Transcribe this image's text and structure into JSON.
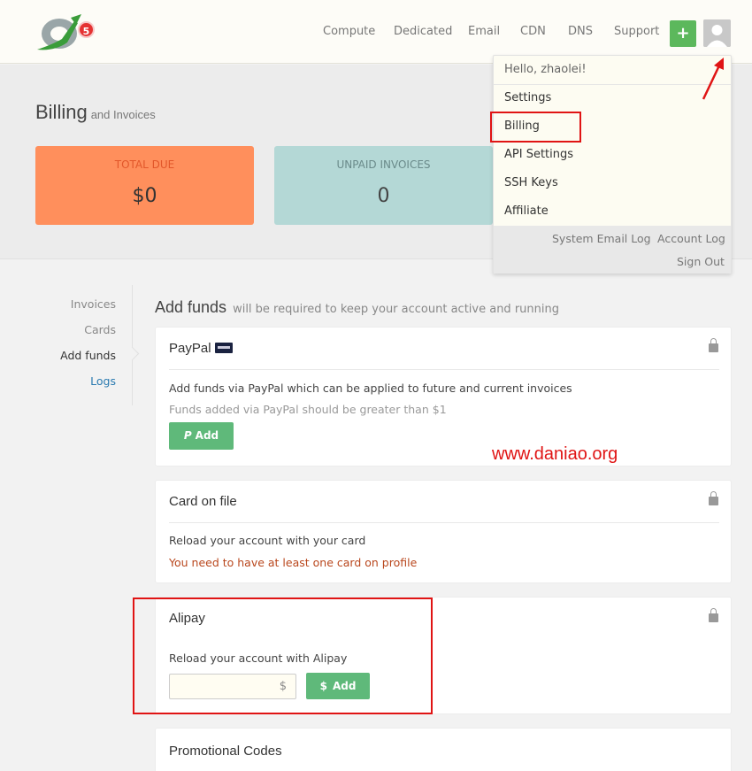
{
  "nav": {
    "items": [
      "Compute",
      "Dedicated",
      "Email",
      "CDN",
      "DNS",
      "Support"
    ],
    "plus_label": "+",
    "notification_count": "5"
  },
  "header": {
    "title": "Billing",
    "subtitle": "and Invoices",
    "total_due_label": "TOTAL DUE",
    "total_due_value": "$0",
    "unpaid_label": "UNPAID INVOICES",
    "unpaid_value": "0"
  },
  "dropdown": {
    "greeting": "Hello, zhaolei!",
    "items": [
      "Settings",
      "Billing",
      "API Settings",
      "SSH Keys",
      "Affiliate"
    ],
    "footer": {
      "system_email_log": "System Email Log",
      "account_log": "Account Log",
      "sign_out": "Sign Out"
    }
  },
  "sidebar": {
    "items": [
      "Invoices",
      "Cards",
      "Add funds",
      "Logs"
    ]
  },
  "main": {
    "title": "Add funds",
    "subtitle": "will be required to keep your account active and running",
    "paypal": {
      "title": "PayPal",
      "desc": "Add funds via PayPal which can be applied to future and current invoices",
      "note": "Funds added via PayPal should be greater than $1",
      "button": "Add",
      "button_icon": "P"
    },
    "card_on_file": {
      "title": "Card on file",
      "desc": "Reload your account with your card",
      "warning": "You need to have at least one card on profile"
    },
    "alipay": {
      "title": "Alipay",
      "desc": "Reload your account with Alipay",
      "input_suffix": "$",
      "button": "Add",
      "button_icon": "$"
    },
    "promo": {
      "title": "Promotional Codes"
    }
  },
  "watermark": "www.daniao.org",
  "colors": {
    "accent_green": "#5fb97a",
    "total_due_bg": "#ff8f5c",
    "unpaid_bg": "#b4d8d6",
    "annotation_red": "#e01414"
  }
}
